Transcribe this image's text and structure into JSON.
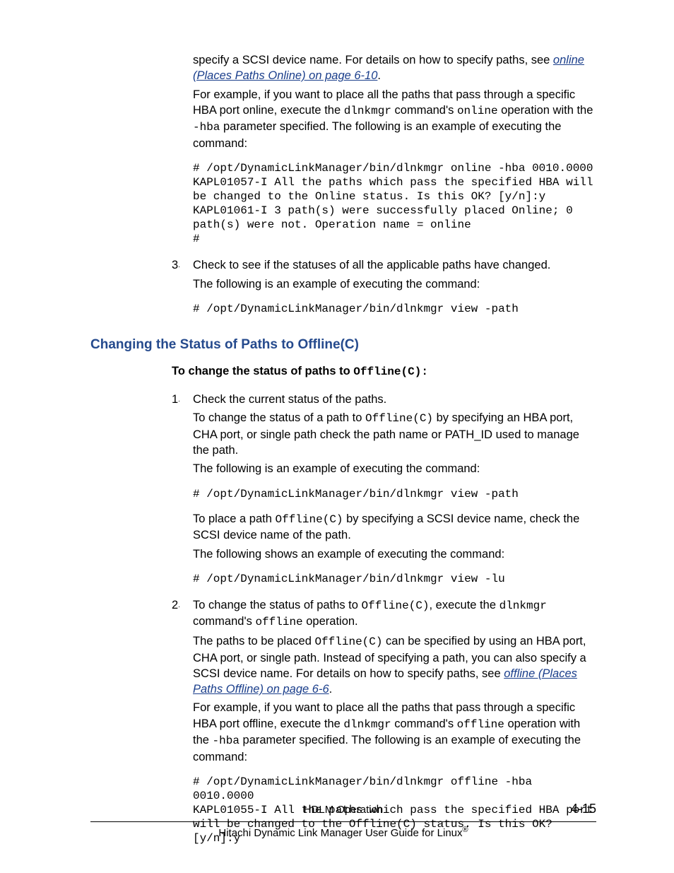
{
  "top": {
    "p1a": "specify a SCSI device name. For details on how to specify paths, see ",
    "link1": "online (Places Paths Online) on page 6-10",
    "p1b": ".",
    "p2a": "For example, if you want to place all the paths that pass through a specific HBA port online, execute the ",
    "p2b": " command's ",
    "p2c": " operation with the ",
    "p2d": " parameter specified. The following is an example of executing the command:",
    "code_dlnkmgr": "dlnkmgr",
    "code_online": "online",
    "code_hba": "-hba",
    "pre1": "# /opt/DynamicLinkManager/bin/dlnkmgr online -hba 0010.0000\nKAPL01057-I All the paths which pass the specified HBA will be changed to the Online status. Is this OK? [y/n]:y\nKAPL01061-I 3 path(s) were successfully placed Online; 0 path(s) were not. Operation name = online\n#"
  },
  "step3": {
    "l1": "Check to see if the statuses of all the applicable paths have changed.",
    "l2": "The following is an example of executing the command:",
    "pre": "# /opt/DynamicLinkManager/bin/dlnkmgr view -path"
  },
  "section": {
    "heading": "Changing the Status of Paths to Offline(C)",
    "intro_a": "To change the status of paths to ",
    "intro_code": "Offline(C):"
  },
  "s1": {
    "l1": "Check the current status of the paths.",
    "l2a": "To change the status of a path to ",
    "l2b": " by specifying an HBA port, CHA port, or single path check the path name or PATH_ID used to manage the path.",
    "l3": "The following is an example of executing the command:",
    "pre1": "# /opt/DynamicLinkManager/bin/dlnkmgr view -path",
    "l4a": "To place a path ",
    "l4b": " by specifying a SCSI device name, check the SCSI device name of the path.",
    "l5": "The following shows an example of executing the command:",
    "pre2": "# /opt/DynamicLinkManager/bin/dlnkmgr view -lu",
    "code_offc": "Offline(C)"
  },
  "s2": {
    "l1a": "To change the status of paths to ",
    "l1b": ", execute the ",
    "l1c": " command's ",
    "l1d": " operation.",
    "l2a": "The paths to be placed ",
    "l2b": " can be specified by using an HBA port, CHA port, or single path. Instead of specifying a path, you can also specify a SCSI device name. For details on how to specify paths, see ",
    "link": "offline (Places Paths Offline) on page 6-6",
    "l2c": ".",
    "l3a": "For example, if you want to place all the paths that pass through a specific HBA port offline, execute the ",
    "l3b": " command's ",
    "l3c": " operation with the ",
    "l3d": " parameter specified. The following is an example of executing the command:",
    "pre": "# /opt/DynamicLinkManager/bin/dlnkmgr offline -hba 0010.0000\nKAPL01055-I All the paths which pass the specified HBA port will be changed to the Offline(C) status. Is this OK? [y/n]:y",
    "code_offc": "Offline(C)",
    "code_dlnkmgr": "dlnkmgr",
    "code_offline": "offline",
    "code_hba": "-hba"
  },
  "footer": {
    "section": "HDLM Operation",
    "book_a": "Hitachi Dynamic Link Manager User Guide for Linux",
    "page": "4-15"
  }
}
